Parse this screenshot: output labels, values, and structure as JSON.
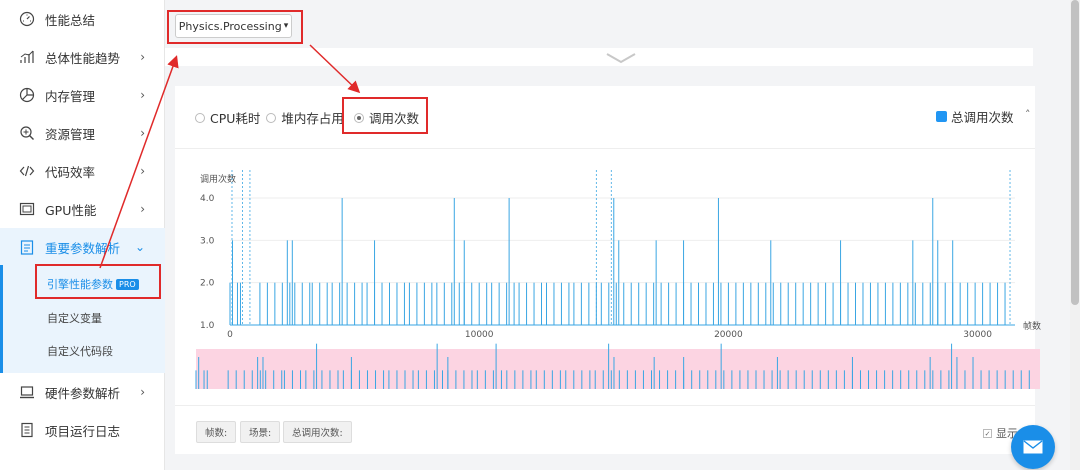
{
  "sidebar": {
    "items": [
      {
        "label": "性能总结",
        "icon": "speedometer-icon",
        "chevron": ""
      },
      {
        "label": "总体性能趋势",
        "icon": "trend-chart-icon",
        "chevron": "›"
      },
      {
        "label": "内存管理",
        "icon": "pie-chart-icon",
        "chevron": "›"
      },
      {
        "label": "资源管理",
        "icon": "resource-icon",
        "chevron": "›"
      },
      {
        "label": "代码效率",
        "icon": "code-icon",
        "chevron": "›"
      },
      {
        "label": "GPU性能",
        "icon": "gpu-icon",
        "chevron": "›"
      },
      {
        "label": "重要参数解析",
        "icon": "clipboard-icon",
        "chevron": "⌄"
      },
      {
        "label": "硬件参数解析",
        "icon": "laptop-icon",
        "chevron": "›"
      },
      {
        "label": "项目运行日志",
        "icon": "document-icon",
        "chevron": ""
      }
    ],
    "subitems": [
      {
        "label": "引擎性能参数",
        "badge": "PRO"
      },
      {
        "label": "自定义变量"
      },
      {
        "label": "自定义代码段"
      }
    ]
  },
  "toolbar": {
    "dropdown_label": "Physics.Processing",
    "dropdown_caret": "▾"
  },
  "panel": {
    "radios": [
      {
        "label": "CPU耗时",
        "selected": false
      },
      {
        "label": "堆内存占用",
        "selected": false
      },
      {
        "label": "调用次数",
        "selected": true
      }
    ],
    "legend_label": "总调用次数",
    "collapse_glyph": "˄",
    "tags": [
      "帧数:",
      "场景:",
      "总调用次数:"
    ],
    "show_label": "显示"
  },
  "colors": {
    "accent": "#1a8ee8",
    "series": "#3aa6e3",
    "overview_bg": "#fcd4e2",
    "annotation": "#e02a2a"
  },
  "chart_data": {
    "type": "line",
    "ylabel": "调用次数",
    "xlabel": "帧数",
    "y_ticks": [
      "4.0",
      "3.0",
      "2.0",
      "1.0"
    ],
    "x_ticks": [
      "0",
      "10000",
      "20000",
      "30000"
    ],
    "ylim": [
      1,
      4
    ],
    "xlim": [
      0,
      31500
    ],
    "series": [
      {
        "baseline": 1,
        "spikes_to_2": [
          0,
          300,
          420,
          1200,
          1500,
          1800,
          2100,
          2400,
          2600,
          2900,
          3200,
          3300,
          3600,
          3900,
          4100,
          4400,
          4700,
          5000,
          5300,
          5500,
          5800,
          6100,
          6400,
          6700,
          7000,
          7200,
          7500,
          7800,
          8100,
          8300,
          8600,
          8900,
          9200,
          9400,
          9700,
          10000,
          10300,
          10500,
          10800,
          11100,
          11400,
          11600,
          11900,
          12200,
          12500,
          12700,
          13000,
          13300,
          13600,
          13800,
          14100,
          14400,
          14700,
          14900,
          15200,
          15500,
          15800,
          16100,
          16400,
          16700,
          17000,
          17300,
          17600,
          17900,
          18200,
          18500,
          18800,
          19100,
          19400,
          19700,
          20000,
          20300,
          20600,
          20900,
          21200,
          21500,
          21800,
          22100,
          22400,
          22700,
          23000,
          23300,
          23600,
          23900,
          24200,
          24500,
          24800,
          25100,
          25400,
          25700,
          26000,
          26300,
          26600,
          26900,
          27200,
          27500,
          27800,
          28100,
          28400,
          28700,
          29000,
          29300,
          29600,
          29900,
          30200,
          30500,
          30800,
          31100
        ],
        "spikes_to_3": [
          100,
          2300,
          2500,
          5800,
          9400,
          15600,
          17100,
          18200,
          21700,
          24500,
          27400,
          28400,
          29000
        ],
        "spikes_to_4": [
          4500,
          9000,
          11200,
          15400,
          19600,
          28200
        ]
      }
    ],
    "markers_dashed": [
      80,
      500,
      800,
      14700,
      15300,
      31300
    ]
  }
}
